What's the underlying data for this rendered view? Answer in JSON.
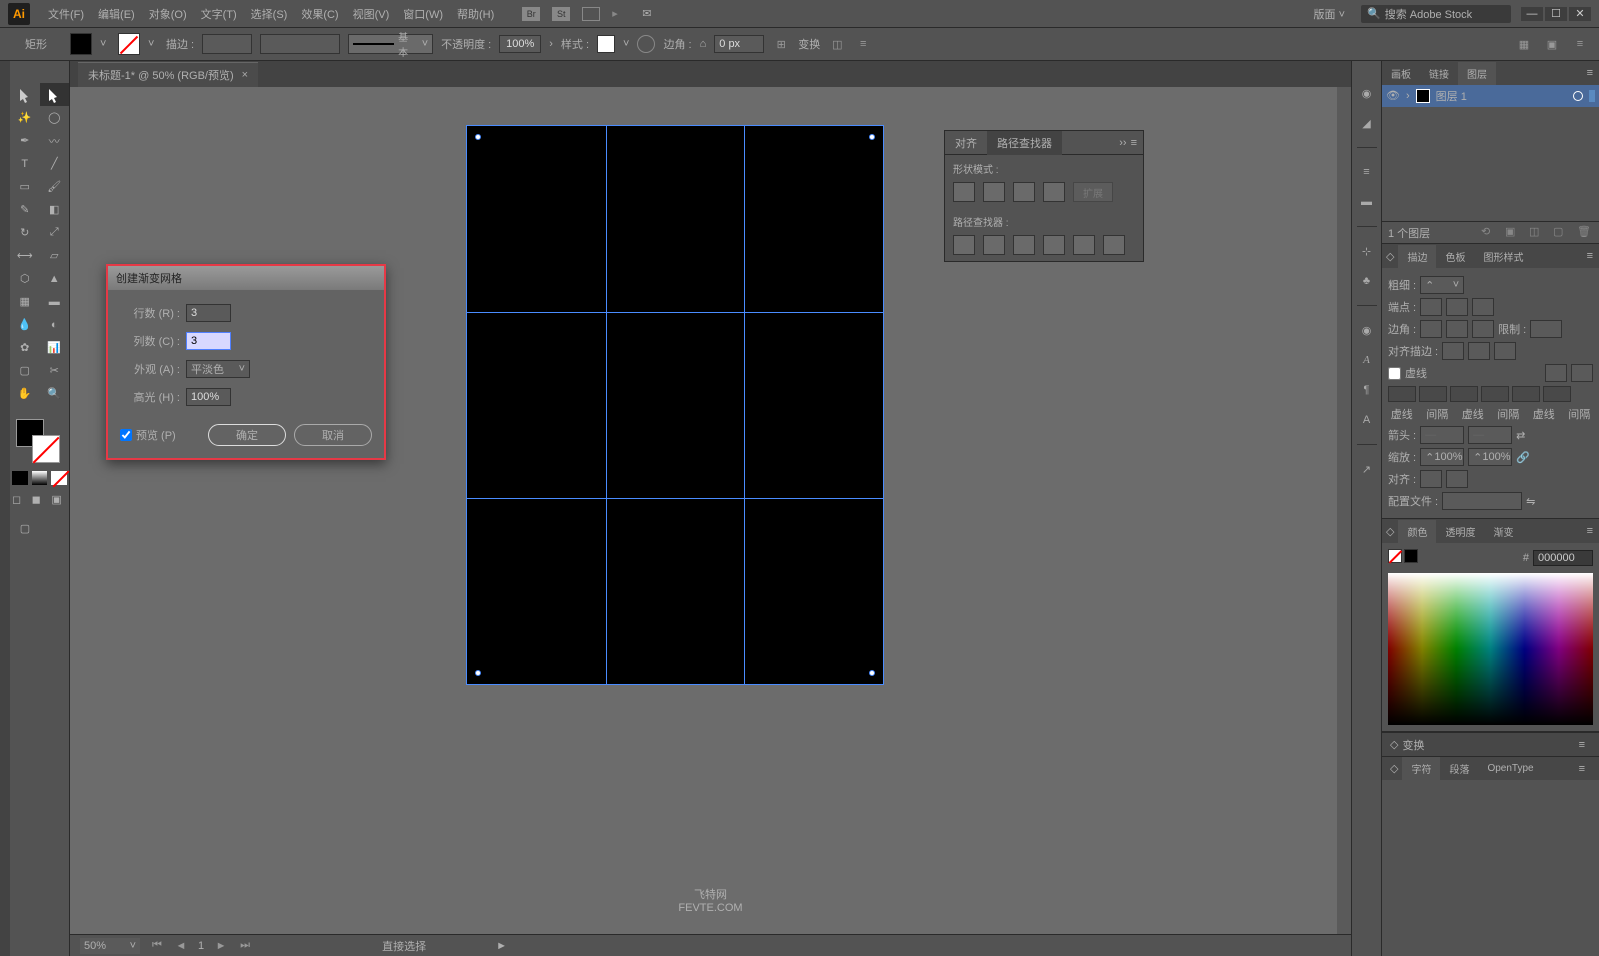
{
  "app": {
    "logo": "Ai"
  },
  "menu": {
    "items": [
      "文件(F)",
      "编辑(E)",
      "对象(O)",
      "文字(T)",
      "选择(S)",
      "效果(C)",
      "视图(V)",
      "窗口(W)",
      "帮助(H)"
    ],
    "workspace_label": "版面",
    "search_placeholder": "搜索 Adobe Stock"
  },
  "control": {
    "shape": "矩形",
    "stroke_label": "描边 :",
    "stroke_basic": "基本",
    "opacity_label": "不透明度 :",
    "opacity_value": "100%",
    "style_label": "样式 :",
    "corner_label": "边角 :",
    "corner_value": "0 px",
    "transform_label": "变换"
  },
  "document": {
    "tab_title": "未标题-1* @ 50% (RGB/预览)"
  },
  "dialog": {
    "title": "创建渐变网格",
    "rows_label": "行数 (R) :",
    "rows_value": "3",
    "cols_label": "列数 (C) :",
    "cols_value": "3",
    "appearance_label": "外观 (A) :",
    "appearance_value": "平淡色",
    "highlight_label": "高光 (H) :",
    "highlight_value": "100%",
    "preview_label": "预览 (P)",
    "ok": "确定",
    "cancel": "取消"
  },
  "align_panel": {
    "tab_align": "对齐",
    "tab_pathfinder": "路径查找器",
    "shape_mode": "形状模式 :",
    "pathfinder": "路径查找器 :",
    "expand": "扩展"
  },
  "layers": {
    "tab_artboard": "画板",
    "tab_links": "链接",
    "tab_layers": "图层",
    "layer_name": "图层 1",
    "count": "1 个图层"
  },
  "stroke_panel": {
    "tab_stroke": "描边",
    "tab_swatches": "色板",
    "tab_graphic": "图形样式",
    "weight": "粗细 :",
    "cap": "端点 :",
    "corner": "边角 :",
    "limit": "限制 :",
    "align_stroke": "对齐描边 :",
    "dashed": "虚线",
    "dash": "虚线",
    "gap": "间隔",
    "arrow": "箭头 :",
    "scale": "缩放 :",
    "scale_val": "100%",
    "align": "对齐 :",
    "profile": "配置文件 :"
  },
  "color_panel": {
    "tab_color": "颜色",
    "tab_opacity": "透明度",
    "tab_gradient": "渐变",
    "hash": "#",
    "hex": "000000"
  },
  "collapsed": {
    "transform": "变换",
    "character": "字符",
    "paragraph": "段落",
    "opentype": "OpenType"
  },
  "status": {
    "zoom": "50%",
    "page": "1",
    "tool": "直接选择"
  },
  "watermark": {
    "line1": "飞特网",
    "line2": "FEVTE.COM"
  }
}
